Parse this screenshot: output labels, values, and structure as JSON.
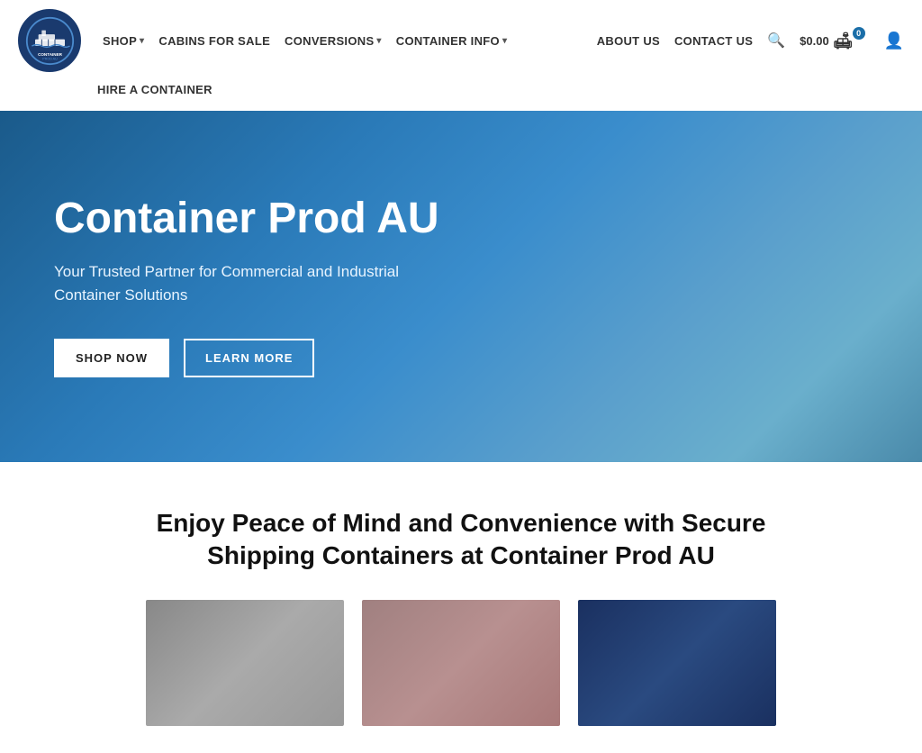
{
  "site": {
    "name": "Container Prod AU"
  },
  "nav": {
    "links_row1": [
      {
        "label": "SHOP",
        "has_dropdown": true
      },
      {
        "label": "CABINS FOR SALE",
        "has_dropdown": false
      },
      {
        "label": "CONVERSIONS",
        "has_dropdown": true
      },
      {
        "label": "CONTAINER INFO",
        "has_dropdown": true
      }
    ],
    "links_row2": [
      {
        "label": "HIRE A CONTAINER",
        "has_dropdown": false
      }
    ],
    "right_links": [
      {
        "label": "ABOUT US"
      },
      {
        "label": "CONTACT US"
      }
    ],
    "cart_price": "$0.00",
    "cart_count": "0"
  },
  "hero": {
    "title": "Container Prod AU",
    "subtitle": "Your Trusted Partner for Commercial and Industrial Container Solutions",
    "btn_shop": "SHOP NOW",
    "btn_learn": "LEARN MORE"
  },
  "section": {
    "title": "Enjoy Peace of Mind and Convenience with Secure Shipping Containers at Container Prod AU"
  },
  "cards": [
    {
      "id": "card-1",
      "style": "gray"
    },
    {
      "id": "card-2",
      "style": "rose"
    },
    {
      "id": "card-3",
      "style": "navy"
    }
  ]
}
